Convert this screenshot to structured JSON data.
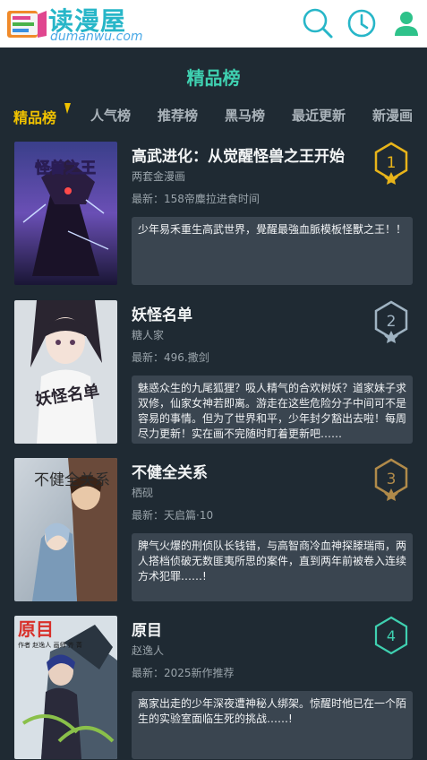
{
  "header": {
    "logo_title": "读漫屋",
    "logo_sub": "dumanwu.com",
    "icons": [
      "search-icon",
      "history-clock-icon",
      "user-icon"
    ],
    "accent": "#27b6c8"
  },
  "page_title": "精品榜",
  "tabs": [
    {
      "label": "精品榜",
      "active": true
    },
    {
      "label": "人气榜",
      "active": false
    },
    {
      "label": "推荐榜",
      "active": false
    },
    {
      "label": "黑马榜",
      "active": false
    },
    {
      "label": "最近更新",
      "active": false
    },
    {
      "label": "新漫画",
      "active": false
    }
  ],
  "items": [
    {
      "title": "高武进化：从觉醒怪兽之王开始",
      "author": "两套金漫画",
      "latest": "最新：158帝麋拉进食时间",
      "desc": "少年易禾重生高武世界，覺醒最強血脈模板怪獸之王！！",
      "rank": "1",
      "rank_color": "#e8b41a",
      "cover_text": "怪兽之王"
    },
    {
      "title": "妖怪名单",
      "author": "糖人家",
      "latest": "最新：496.撒剑",
      "desc": "魅惑众生的九尾狐狸？吸人精气的合欢树妖？道家妹子求双修，仙家女神若即离。游走在这些危险分子中间可不是容易的事情。但为了世界和平，少年封夕豁出去啦！每周尽力更新！实在画不完随时盯着更新吧……",
      "rank": "2",
      "rank_color": "#9fb3c2",
      "cover_text": "妖怪名单"
    },
    {
      "title": "不健全关系",
      "author": "栖砚",
      "latest": "最新：天启篇·10",
      "desc": "脾气火爆的刑侦队长钱错，与高智商冷血神探滕瑞雨，两人搭档侦破无数匪夷所思的案件，直到两年前被卷入连续方术犯罪……!",
      "rank": "3",
      "rank_color": "#b08a4a",
      "cover_text": "不健全关系"
    },
    {
      "title": "原目",
      "author": "赵逸人",
      "latest": "最新：2025新作推荐",
      "desc": "离家出走的少年深夜遭神秘人绑架。惊醒时他已在一个陌生的实验室面临生死的挑战……!",
      "rank": "4",
      "rank_color": "#3fd0b0",
      "cover_text": "原目",
      "cover_credit": "作者 赵逸人 画师 齐 菁"
    }
  ]
}
